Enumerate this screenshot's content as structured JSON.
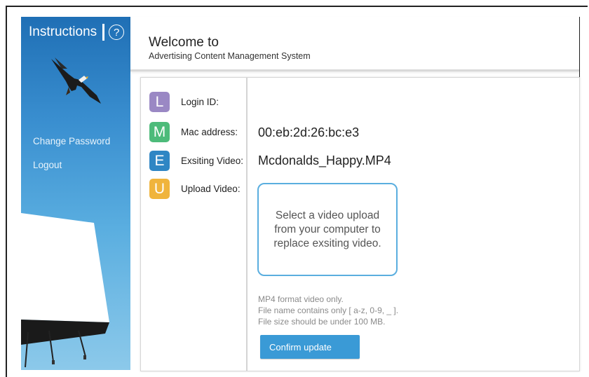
{
  "sidebar": {
    "instructions_label": "Instructions",
    "help_icon": "?",
    "links": [
      "Change Password",
      "Logout"
    ],
    "gradient_colors": [
      "#1f6fb5",
      "#8cc9ea"
    ]
  },
  "header": {
    "welcome": "Welcome to",
    "subtitle": "Advertising Content Management System"
  },
  "fields": [
    {
      "letter": "L",
      "label": "Login ID:",
      "color": "#9a88c4",
      "value": ""
    },
    {
      "letter": "M",
      "label": "Mac address:",
      "color": "#4dbb7a",
      "value": "00:eb:2d:26:bc:e3"
    },
    {
      "letter": "E",
      "label": "Exsiting Video:",
      "color": "#2f86c4",
      "value": "Mcdonalds_Happy.MP4"
    },
    {
      "letter": "U",
      "label": "Upload Video:",
      "color": "#f0b43c",
      "value": ""
    }
  ],
  "upload": {
    "prompt": "Select a video upload from your computer to replace exsiting video."
  },
  "notes": [
    "MP4 format video only.",
    "File name contains only [ a-z, 0-9, _ ].",
    "File size should be under 100 MB."
  ],
  "confirm_button": "Confirm update",
  "accent_color": "#3a9ad6"
}
